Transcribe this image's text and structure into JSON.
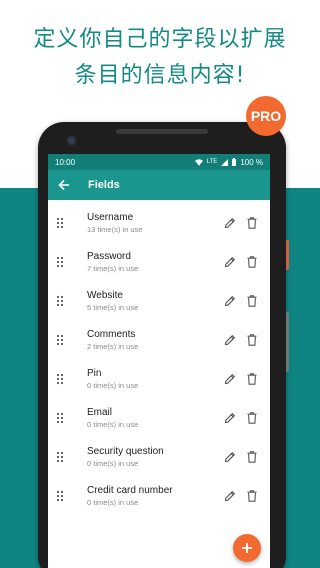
{
  "promo": {
    "line1": "定义你自己的字段以扩展",
    "line2": "条目的信息内容!"
  },
  "badge": {
    "label": "PRO",
    "color": "#f26a2f"
  },
  "status_bar": {
    "time": "10:00",
    "network": "LTE",
    "battery": "100 %"
  },
  "app_bar": {
    "title": "Fields",
    "back_icon": "arrow-left-icon",
    "color": "#1a968f"
  },
  "fields": [
    {
      "name": "Username",
      "usage": "13 time(s) in use"
    },
    {
      "name": "Password",
      "usage": "7 time(s) in use"
    },
    {
      "name": "Website",
      "usage": "5 time(s) in use"
    },
    {
      "name": "Comments",
      "usage": "2 time(s) in use"
    },
    {
      "name": "Pin",
      "usage": "0 time(s) in use"
    },
    {
      "name": "Email",
      "usage": "0 time(s) in use"
    },
    {
      "name": "Security question",
      "usage": "0 time(s) in use"
    },
    {
      "name": "Credit card number",
      "usage": "0 time(s) in use"
    }
  ],
  "row_icons": {
    "drag": "drag-handle-icon",
    "edit": "pencil-icon",
    "delete": "trash-icon"
  },
  "fab": {
    "icon": "plus-icon",
    "color": "#f26a2f"
  },
  "colors": {
    "headline": "#138a84",
    "band": "#0f8583",
    "status_bar": "#117e78"
  }
}
